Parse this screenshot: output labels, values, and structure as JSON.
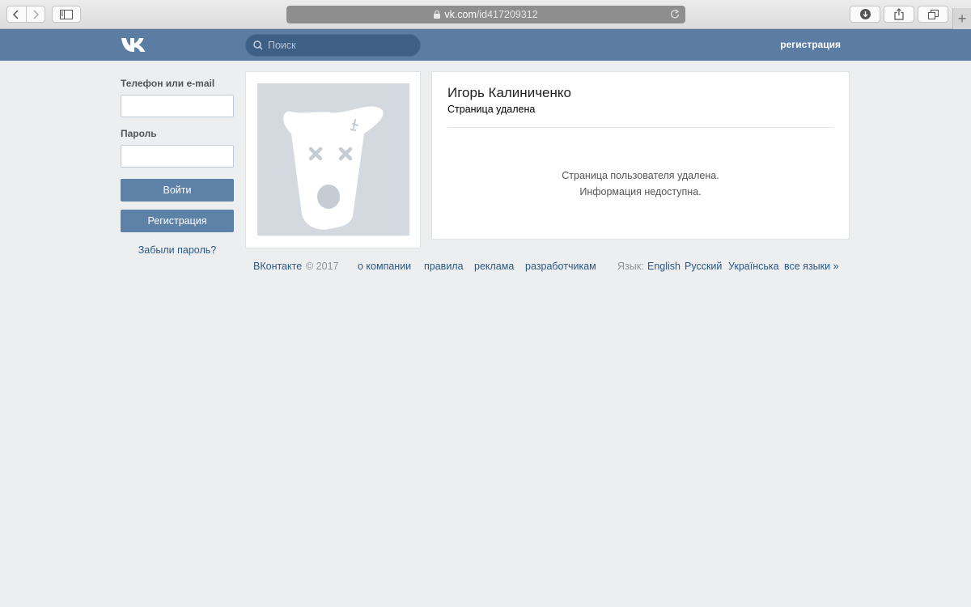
{
  "browser": {
    "url_host": "vk.com",
    "url_path": "/id417209312",
    "icons": [
      "back-icon",
      "forward-icon",
      "sidebar-icon",
      "lock-icon",
      "reload-icon",
      "download-icon",
      "share-icon",
      "tabs-icon",
      "plus-icon"
    ],
    "new_tab_label": "+"
  },
  "header": {
    "logo": "vk-logo",
    "search_placeholder": "Поиск",
    "register_link": "регистрация",
    "bg_color": "#5b7ca3"
  },
  "login": {
    "phone_label": "Телефон или e-mail",
    "phone_value": "",
    "password_label": "Пароль",
    "password_value": "",
    "login_button": "Войти",
    "register_button": "Регистрация",
    "forgot_link": "Забыли пароль?",
    "button_color": "#5e81a8"
  },
  "profile": {
    "avatar": "deactivated-dog-avatar",
    "name": "Игорь Калиниченко",
    "status": "Страница удалена",
    "message_line1": "Страница пользователя удалена.",
    "message_line2": "Информация недоступна."
  },
  "footer": {
    "brand": "ВКонтакте",
    "copyright": "© 2017",
    "links": [
      "о компании",
      "правила",
      "реклама",
      "разработчикам"
    ],
    "language_label": "Язык:",
    "languages": [
      "English",
      "Русский",
      "Українська",
      "все языки »"
    ],
    "link_color": "#2a5885"
  }
}
